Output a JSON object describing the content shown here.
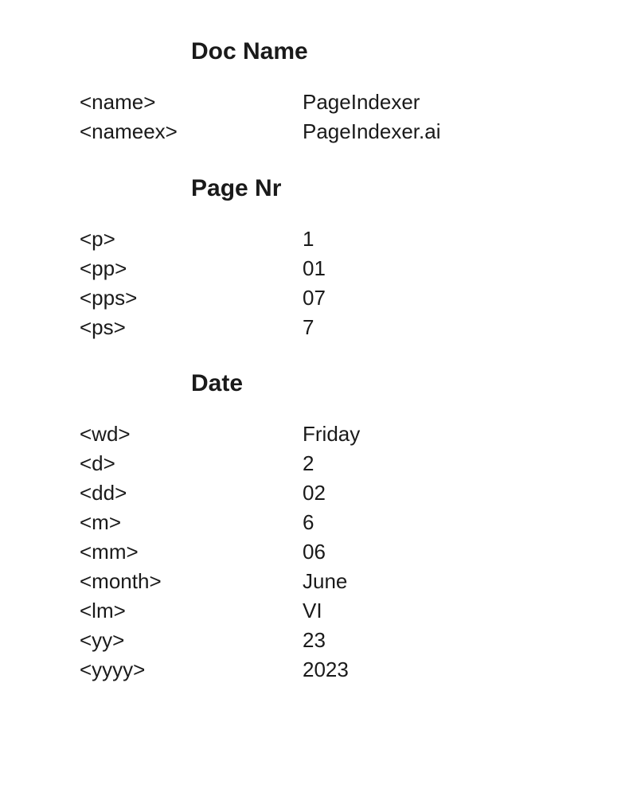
{
  "sections": {
    "docName": {
      "heading": "Doc Name",
      "rows": [
        {
          "key": "<name>",
          "value": "PageIndexer"
        },
        {
          "key": "<nameex>",
          "value": "PageIndexer.ai"
        }
      ]
    },
    "pageNr": {
      "heading": "Page Nr",
      "rows": [
        {
          "key": "<p>",
          "value": "1"
        },
        {
          "key": "<pp>",
          "value": "01"
        },
        {
          "key": "<pps>",
          "value": "07"
        },
        {
          "key": "<ps>",
          "value": "7"
        }
      ]
    },
    "date": {
      "heading": "Date",
      "rows": [
        {
          "key": "<wd>",
          "value": "Friday"
        },
        {
          "key": "<d>",
          "value": "2"
        },
        {
          "key": "<dd>",
          "value": "02"
        },
        {
          "key": "<m>",
          "value": "6"
        },
        {
          "key": "<mm>",
          "value": "06"
        },
        {
          "key": "<month>",
          "value": "June"
        },
        {
          "key": "<lm>",
          "value": "VI"
        },
        {
          "key": "<yy>",
          "value": "23"
        },
        {
          "key": "<yyyy>",
          "value": "2023"
        }
      ]
    }
  }
}
